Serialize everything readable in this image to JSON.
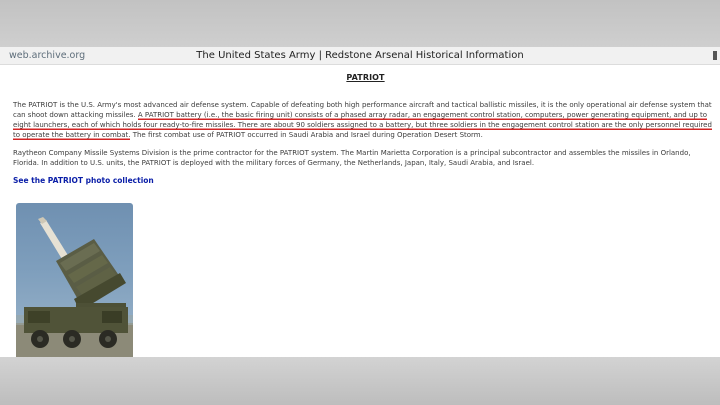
{
  "browser": {
    "url": "web.archive.org",
    "page_title": "The United States Army | Redstone Arsenal Historical Information"
  },
  "article": {
    "heading": "PATRIOT",
    "p1_part1": "The PATRIOT is the U.S. Army's most advanced air defense system. Capable of defeating both high performance aircraft and tactical ballistic missiles, it is the only operational air defense system that can shoot down attacking missiles. ",
    "p1_highlight": "A PATRIOT battery (i.e., the basic firing unit) consists of a phased array radar, an engagement control station, computers, power generating equipment, and up to eight launchers, each of which holds four ready-to-fire missiles. There are about 90 soldiers assigned to a battery, but three soldiers in the engagement control station are the only personnel required to operate the battery in combat.",
    "p1_part2": " The first combat use of PATRIOT occurred in Saudi Arabia and Israel during Operation Desert Storm.",
    "p2": "Raytheon Company Missile Systems Division is the prime contractor for the PATRIOT system. The Martin Marietta Corporation is a principal subcontractor and assembles the missiles in Orlando, Florida. In addition to U.S. units, the PATRIOT is deployed with the military forces of Germany, the Netherlands, Japan, Italy, Saudi Arabia, and Israel.",
    "photo_link": "See the PATRIOT photo collection"
  },
  "colors": {
    "highlight_underline": "#d22424",
    "link": "#0b1fa8"
  },
  "icons": [
    "menu-icon"
  ]
}
